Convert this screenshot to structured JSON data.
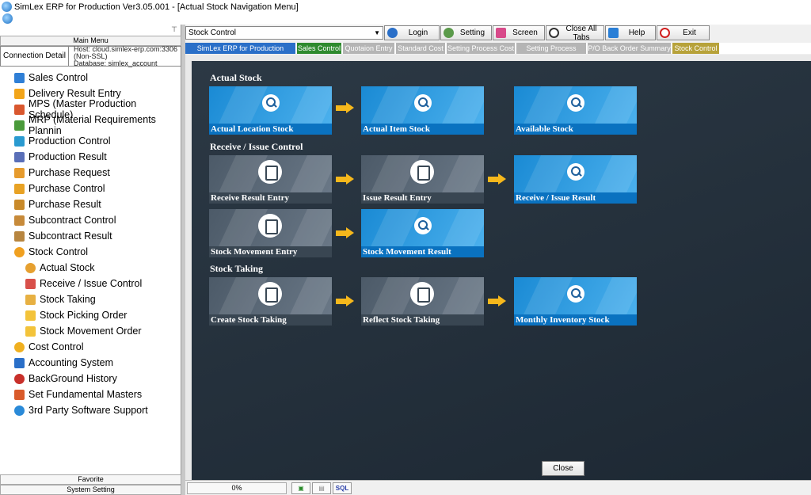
{
  "window": {
    "title": "SimLex ERP for Production Ver3.05.001 - [Actual Stock Navigation Menu]"
  },
  "left_panel": {
    "main_menu_label": "Main Menu",
    "connection": {
      "label": "Connection Detail",
      "host": "Host: cloud.simlex-erp.com:3306",
      "ssl": "(Non-SSL)",
      "database": "Database: simlex_account"
    },
    "nav": [
      {
        "label": "Sales Control",
        "icon": "sales-icon",
        "color": "#2f7fd6"
      },
      {
        "label": "Delivery Result Entry",
        "icon": "delivery-icon",
        "color": "#f2a51a"
      },
      {
        "label": "MPS (Master Production Schedule)",
        "icon": "mps-icon",
        "color": "#d9572e"
      },
      {
        "label": "MRP (Material Requirements Plannin",
        "icon": "mrp-icon",
        "color": "#4a9a3a"
      },
      {
        "label": "Production Control",
        "icon": "production-icon",
        "color": "#2a9ad0"
      },
      {
        "label": "Production Result",
        "icon": "production-result-icon",
        "color": "#5a6fb8"
      },
      {
        "label": "Purchase Request",
        "icon": "purchase-request-icon",
        "color": "#e69b2d"
      },
      {
        "label": "Purchase Control",
        "icon": "cart-icon",
        "color": "#e8a224"
      },
      {
        "label": "Purchase Result",
        "icon": "basket-icon",
        "color": "#c98a2a"
      },
      {
        "label": "Subcontract Control",
        "icon": "subcontract-icon",
        "color": "#c78a3a"
      },
      {
        "label": "Subcontract Result",
        "icon": "subcontract-result-icon",
        "color": "#b7853f"
      },
      {
        "label": "Stock Control",
        "icon": "search-icon",
        "color": "#f0a020"
      }
    ],
    "sub_nav": [
      {
        "label": "Actual Stock",
        "icon": "magnifier-icon",
        "color": "#e6a030"
      },
      {
        "label": "Receive / Issue Control",
        "icon": "receive-issue-icon",
        "color": "#d8504a"
      },
      {
        "label": "Stock Taking",
        "icon": "stock-taking-icon",
        "color": "#e7b042"
      },
      {
        "label": "Stock Picking Order",
        "icon": "folder-icon",
        "color": "#f3c33a"
      },
      {
        "label": "Stock Movement Order",
        "icon": "folder-icon",
        "color": "#f3c33a"
      }
    ],
    "nav_after": [
      {
        "label": "Cost Control",
        "icon": "coin-icon",
        "color": "#f0b020"
      },
      {
        "label": "Accounting System",
        "icon": "bank-icon",
        "color": "#2a6fc8"
      },
      {
        "label": "BackGround History",
        "icon": "history-icon",
        "color": "#c8302a"
      },
      {
        "label": "Set Fundamental Masters",
        "icon": "masters-icon",
        "color": "#d95a2a"
      },
      {
        "label": "3rd Party Software Support",
        "icon": "gear-icon",
        "color": "#2a8ad8"
      }
    ],
    "favorite_label": "Favorite",
    "system_setting_label": "System Setting"
  },
  "toolbar": {
    "combo_value": "Stock Control",
    "buttons": [
      {
        "label": "Login",
        "icon": "user-icon"
      },
      {
        "label": "Setting",
        "icon": "gear-icon"
      },
      {
        "label": "Screen",
        "icon": "screen-icon"
      },
      {
        "label": "Close All Tabs",
        "icon": "refresh-icon"
      },
      {
        "label": "Help",
        "icon": "help-icon"
      },
      {
        "label": "Exit",
        "icon": "power-icon"
      }
    ]
  },
  "tabs": [
    {
      "label": "SimLex ERP for Production Control",
      "color": "#2a6fc8"
    },
    {
      "label": "Sales Control",
      "color": "#2e8a2e"
    },
    {
      "label": "Quotaion Entry",
      "color": "#b8b8b8"
    },
    {
      "label": "Standard Cost",
      "color": "#b8b8b8"
    },
    {
      "label": "Setting Process Cost",
      "color": "#b8b8b8"
    },
    {
      "label": "Setting Process Group",
      "color": "#b8b8b8"
    },
    {
      "label": "P/O Back Order Summary",
      "color": "#b8b8b8"
    },
    {
      "label": "Stock Control",
      "color": "#b7a23a"
    }
  ],
  "sections": {
    "actual_stock": "Actual Stock",
    "receive_issue": "Receive / Issue Control",
    "stock_taking": "Stock Taking"
  },
  "tiles": {
    "actual_location_stock": "Actual Location Stock",
    "actual_item_stock": "Actual Item Stock",
    "available_stock": "Available Stock",
    "receive_result_entry": "Receive Result Entry",
    "issue_result_entry": "Issue Result Entry",
    "receive_issue_result": "Receive / Issue Result",
    "stock_movement_entry": "Stock Movement Entry",
    "stock_movement_result": "Stock Movement Result",
    "create_stock_taking": "Create Stock Taking",
    "reflect_stock_taking": "Reflect Stock Taking",
    "monthly_inventory_stock": "Monthly Inventory Stock"
  },
  "close_button": "Close",
  "status": {
    "progress": "0%",
    "sql": "SQL"
  }
}
